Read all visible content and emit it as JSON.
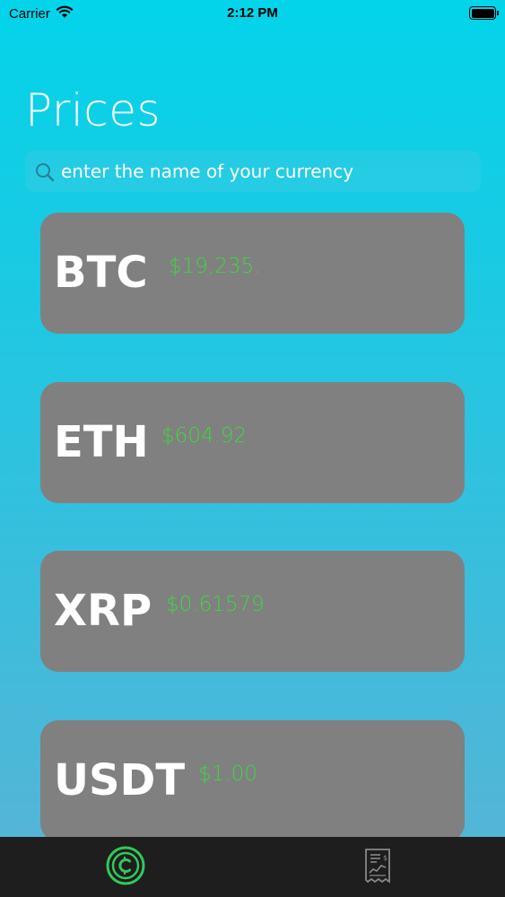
{
  "status_bar": {
    "carrier": "Carrier",
    "time": "2:12 PM",
    "wifi_icon": "wifi-icon",
    "battery_icon": "battery-icon"
  },
  "page": {
    "title": "Prices"
  },
  "search": {
    "placeholder": "enter the name of your currency",
    "icon": "search-icon"
  },
  "coins": [
    {
      "symbol": "BTC",
      "price": "$19,235."
    },
    {
      "symbol": "ETH",
      "price": "$604.92"
    },
    {
      "symbol": "XRP",
      "price": "$0.61579"
    },
    {
      "symbol": "USDT",
      "price": "$1.00"
    }
  ],
  "tab_bar": {
    "tabs": [
      {
        "icon": "coin-icon",
        "selected": true
      },
      {
        "icon": "receipt-chart-icon",
        "selected": false
      }
    ]
  },
  "colors": {
    "price_green": "#3ed63e",
    "card_gray": "#808080",
    "tab_bar_bg": "#1e1e1e",
    "accent_green": "#34c759"
  }
}
